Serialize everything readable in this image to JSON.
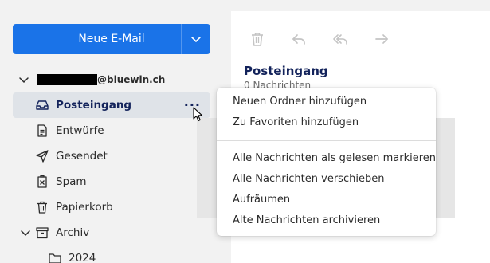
{
  "sidebar": {
    "new_mail_label": "Neue E-Mail",
    "account_suffix": "@bluewin.ch",
    "folders": [
      {
        "label": "Posteingang",
        "icon": "inbox-icon",
        "active": true
      },
      {
        "label": "Entwürfe",
        "icon": "draft-icon"
      },
      {
        "label": "Gesendet",
        "icon": "send-icon"
      },
      {
        "label": "Spam",
        "icon": "spam-icon"
      },
      {
        "label": "Papierkorb",
        "icon": "trash-icon"
      },
      {
        "label": "Archiv",
        "icon": "archive-icon"
      },
      {
        "label": "2024",
        "icon": "folder-icon"
      }
    ]
  },
  "main": {
    "title": "Posteingang",
    "count": "0 Nachrichten"
  },
  "context_menu": {
    "items": [
      "Neuen Ordner hinzufügen",
      "Zu Favoriten hinzufügen",
      "Alle Nachrichten als gelesen markieren",
      "Alle Nachrichten verschieben",
      "Aufräumen",
      "Alte Nachrichten archivieren"
    ]
  },
  "colors": {
    "accent": "#1a73e8",
    "active_bg": "#dfe3e8",
    "active_text": "#13235b"
  }
}
